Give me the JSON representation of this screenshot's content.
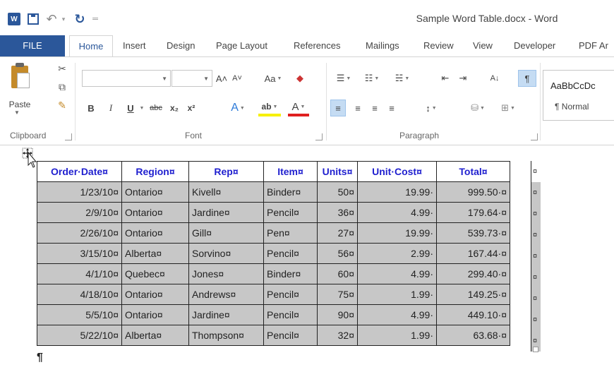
{
  "titlebar": {
    "document_title": "Sample Word Table.docx - Word",
    "word_logo": "W",
    "save_icon": "save-icon",
    "undo_icon": "undo-icon",
    "redo_icon": "redo-icon",
    "undo_glyph": "↶",
    "redo_glyph": "↻",
    "customize_glyph": "═"
  },
  "tabs": [
    {
      "label": "FILE"
    },
    {
      "label": "Home"
    },
    {
      "label": "Insert"
    },
    {
      "label": "Design"
    },
    {
      "label": "Page Layout"
    },
    {
      "label": "References"
    },
    {
      "label": "Mailings"
    },
    {
      "label": "Review"
    },
    {
      "label": "View"
    },
    {
      "label": "Developer"
    },
    {
      "label": "PDF Ar"
    }
  ],
  "ribbon": {
    "clipboard": {
      "group_label": "Clipboard",
      "paste_label": "Paste"
    },
    "font": {
      "group_label": "Font",
      "font_name": "",
      "font_size": "",
      "grow": "A˄",
      "shrink": "A˅",
      "change_case": "Aa",
      "bold": "B",
      "italic": "I",
      "underline": "U",
      "strikethrough": "abc",
      "subscript": "x₂",
      "superscript": "x²",
      "text_effects": "A",
      "highlight": "ab",
      "font_color": "A"
    },
    "paragraph": {
      "group_label": "Paragraph",
      "pilcrow": "¶",
      "sort": "A↓"
    },
    "styles": {
      "sample": "AaBbCcDc",
      "name": "¶ Normal"
    }
  },
  "table": {
    "headers": [
      "Order·Date¤",
      "Region¤",
      "Rep¤",
      "Item¤",
      "Units¤",
      "Unit·Cost¤",
      "Total¤"
    ],
    "rows": [
      [
        "1/23/10¤",
        "Ontario¤",
        "Kivell¤",
        "Binder¤",
        "50¤",
        "19.99·",
        "999.50·¤"
      ],
      [
        "2/9/10¤",
        "Ontario¤",
        "Jardine¤",
        "Pencil¤",
        "36¤",
        "4.99·",
        "179.64·¤"
      ],
      [
        "2/26/10¤",
        "Ontario¤",
        "Gill¤",
        "Pen¤",
        "27¤",
        "19.99·",
        "539.73·¤"
      ],
      [
        "3/15/10¤",
        "Alberta¤",
        "Sorvino¤",
        "Pencil¤",
        "56¤",
        "2.99·",
        "167.44·¤"
      ],
      [
        "4/1/10¤",
        "Quebec¤",
        "Jones¤",
        "Binder¤",
        "60¤",
        "4.99·",
        "299.40·¤"
      ],
      [
        "4/18/10¤",
        "Ontario¤",
        "Andrews¤",
        "Pencil¤",
        "75¤",
        "1.99·",
        "149.25·¤"
      ],
      [
        "5/5/10¤",
        "Ontario¤",
        "Jardine¤",
        "Pencil¤",
        "90¤",
        "4.99·",
        "449.10·¤"
      ],
      [
        "5/22/10¤",
        "Alberta¤",
        "Thompson¤",
        "Pencil¤",
        "32¤",
        "1.99·",
        "63.68·¤"
      ]
    ],
    "end_of_row_mark": "¤",
    "header_color": "#1f1fcf",
    "selected_fill": "#c7c7c7"
  },
  "document": {
    "paragraph_mark": "¶"
  },
  "colors": {
    "accent": "#2b579a"
  }
}
